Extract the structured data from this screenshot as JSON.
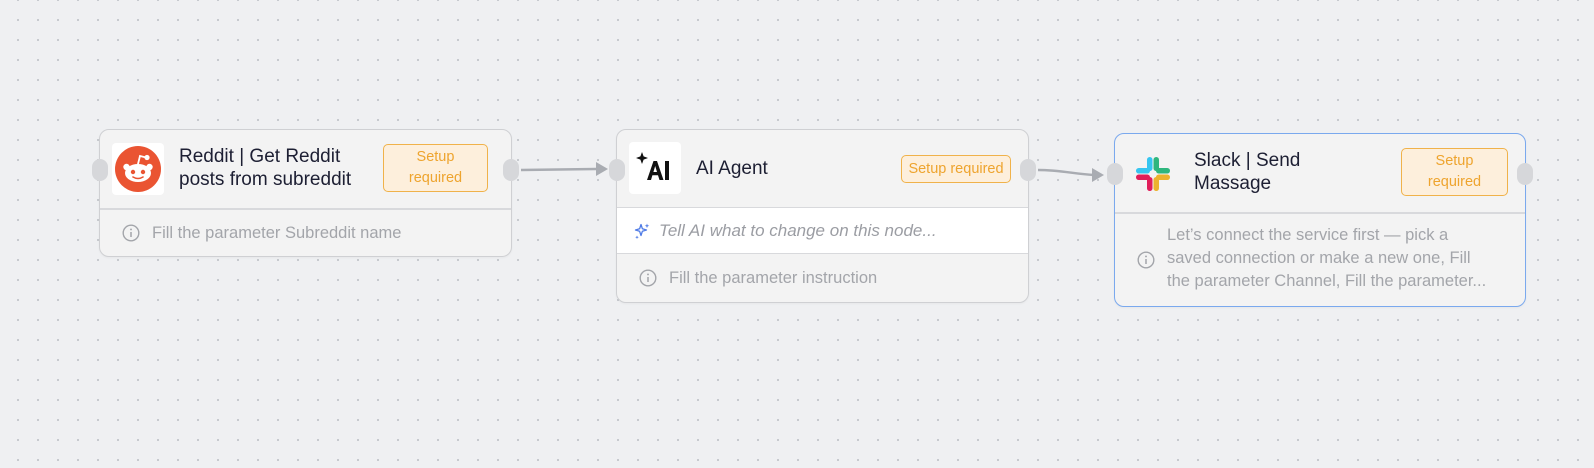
{
  "nodes": {
    "reddit": {
      "title_line1": "Reddit | Get Reddit",
      "title_line2": "posts from subreddit",
      "badge_line1": "Setup",
      "badge_line2": "required",
      "footer": "Fill the parameter Subreddit name",
      "icon": "reddit-icon"
    },
    "ai_agent": {
      "title": "AI Agent",
      "badge": "Setup required",
      "prompt_placeholder": "Tell AI what to change on this node...",
      "footer": "Fill the parameter instruction",
      "icon": "ai-agent-icon"
    },
    "slack": {
      "title_line1": "Slack | Send",
      "title_line2": "Massage",
      "badge_line1": "Setup",
      "badge_line2": "required",
      "footer_line1": "Let’s connect the service first — pick a",
      "footer_line2": "saved connection or make a new one, Fill",
      "footer_line3": "the parameter Channel, Fill the parameter...",
      "icon": "slack-icon"
    }
  },
  "colors": {
    "badge_border": "#f0b24a",
    "badge_bg": "#fdefdc",
    "badge_text": "#eea42e",
    "reddit_orange": "#ff4500",
    "selected_border": "#7aa9ee",
    "edge": "#a9acb2"
  }
}
